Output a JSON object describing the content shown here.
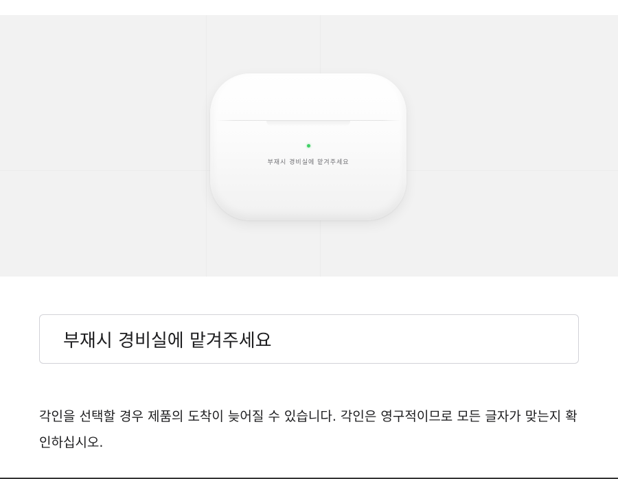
{
  "engraving": {
    "preview_text": "부재시 경비실에 맡겨주세요",
    "input_value": "부재시 경비실에 맡겨주세요",
    "status_light_color": "#3fd065"
  },
  "notice": {
    "text": "각인을 선택할 경우 제품의 도착이 늦어질 수 있습니다. 각인은 영구적이므로 모든 글자가 맞는지 확인하십시오."
  },
  "colors": {
    "preview_background": "#f2f2f2",
    "field_border": "#d2d2d7",
    "text": "#1d1d1f"
  }
}
